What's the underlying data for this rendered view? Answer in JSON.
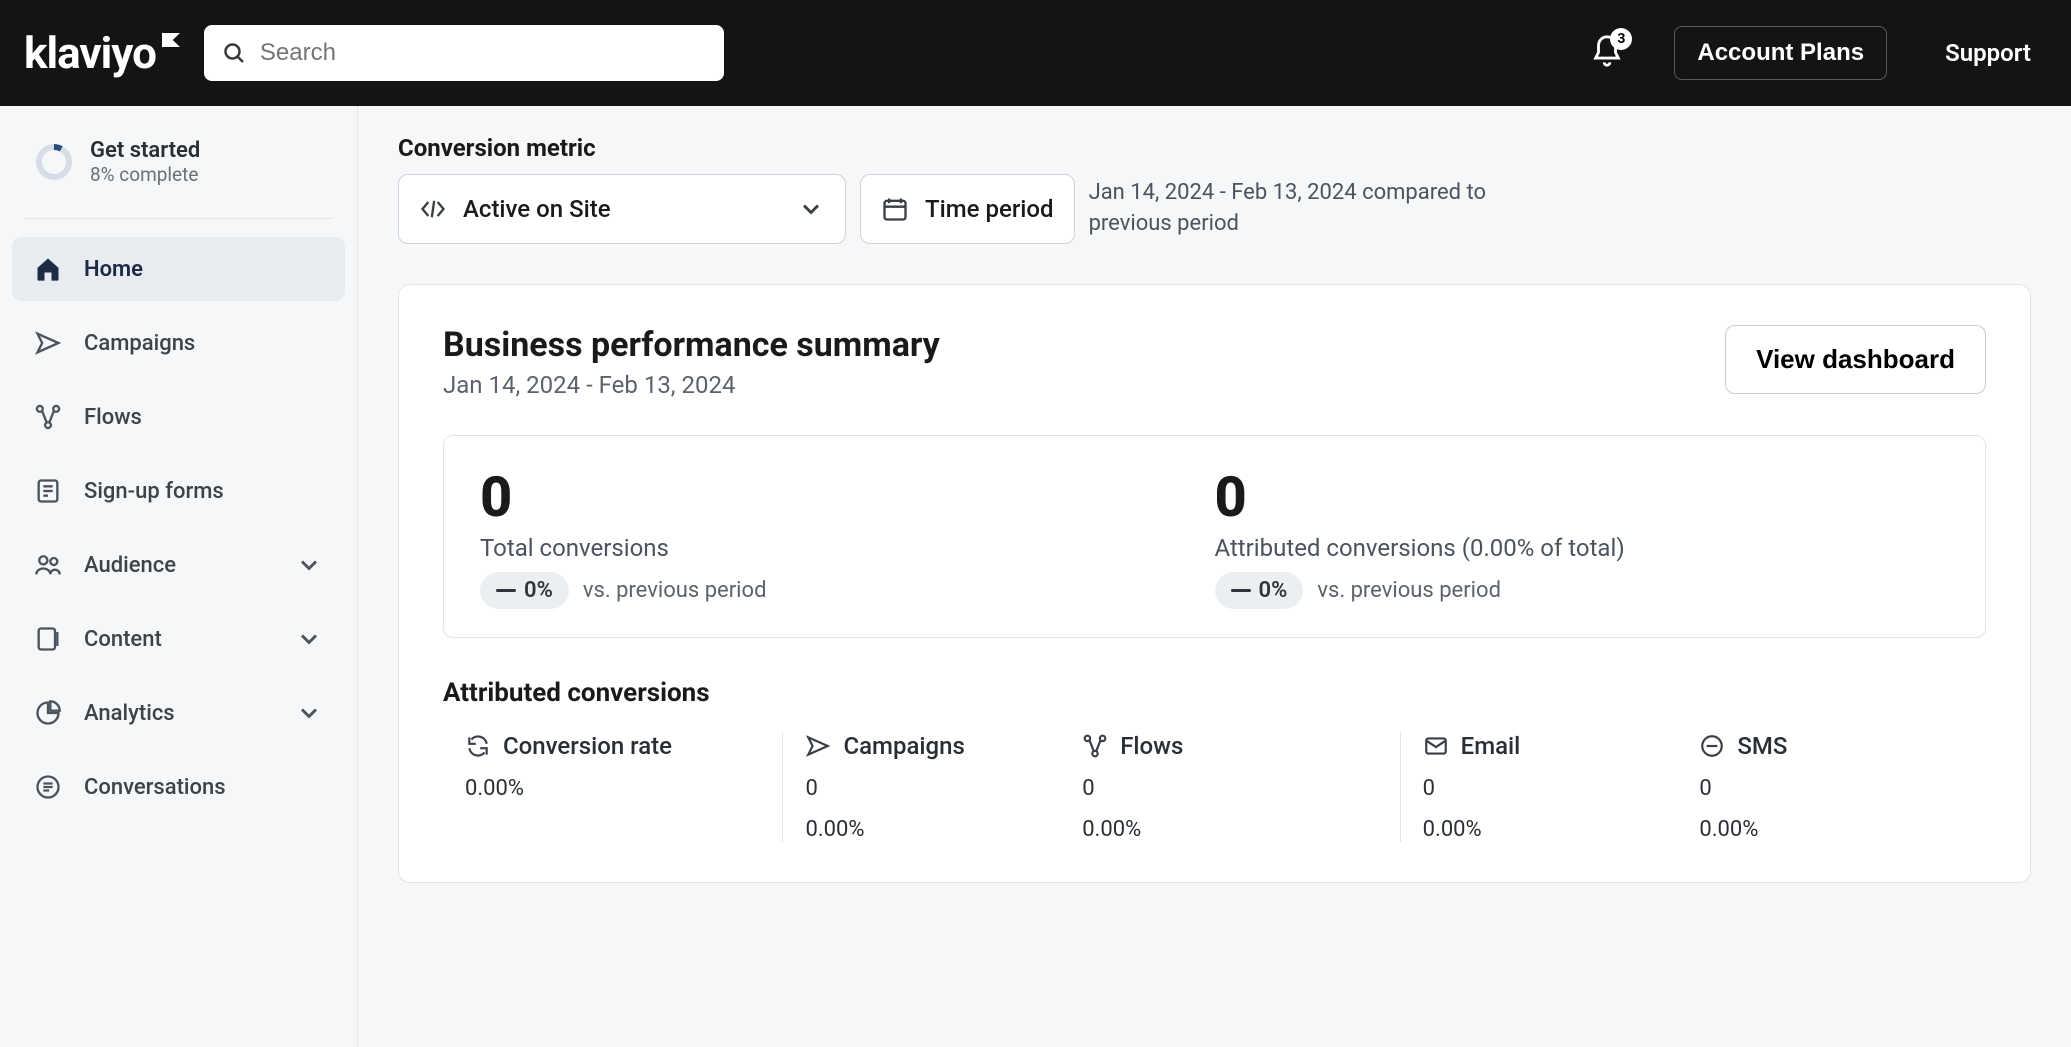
{
  "header": {
    "logo_text": "klaviyo",
    "search_placeholder": "Search",
    "notification_count": "3",
    "account_plans_label": "Account Plans",
    "support_label": "Support"
  },
  "sidebar": {
    "get_started": {
      "title": "Get started",
      "subtitle": "8% complete"
    },
    "items": [
      {
        "label": "Home"
      },
      {
        "label": "Campaigns"
      },
      {
        "label": "Flows"
      },
      {
        "label": "Sign-up forms"
      },
      {
        "label": "Audience"
      },
      {
        "label": "Content"
      },
      {
        "label": "Analytics"
      },
      {
        "label": "Conversations"
      }
    ]
  },
  "controls": {
    "metric_heading": "Conversion metric",
    "metric_selected": "Active on Site",
    "time_button": "Time period",
    "compare_text": "Jan 14, 2024 - Feb 13, 2024 compared to previous period"
  },
  "summary": {
    "title": "Business performance summary",
    "date_range": "Jan 14, 2024 - Feb 13, 2024",
    "view_dashboard": "View dashboard",
    "kpis": {
      "total_value": "0",
      "total_label": "Total conversions",
      "total_delta": "0%",
      "total_vs": "vs. previous period",
      "attr_value": "0",
      "attr_label": "Attributed conversions (0.00% of total)",
      "attr_delta": "0%",
      "attr_vs": "vs. previous period"
    },
    "attributed_heading": "Attributed conversions",
    "cols": {
      "conv_rate_label": "Conversion rate",
      "conv_rate_value": "0.00%",
      "campaigns_label": "Campaigns",
      "campaigns_v1": "0",
      "campaigns_v2": "0.00%",
      "flows_label": "Flows",
      "flows_v1": "0",
      "flows_v2": "0.00%",
      "email_label": "Email",
      "email_v1": "0",
      "email_v2": "0.00%",
      "sms_label": "SMS",
      "sms_v1": "0",
      "sms_v2": "0.00%"
    }
  }
}
